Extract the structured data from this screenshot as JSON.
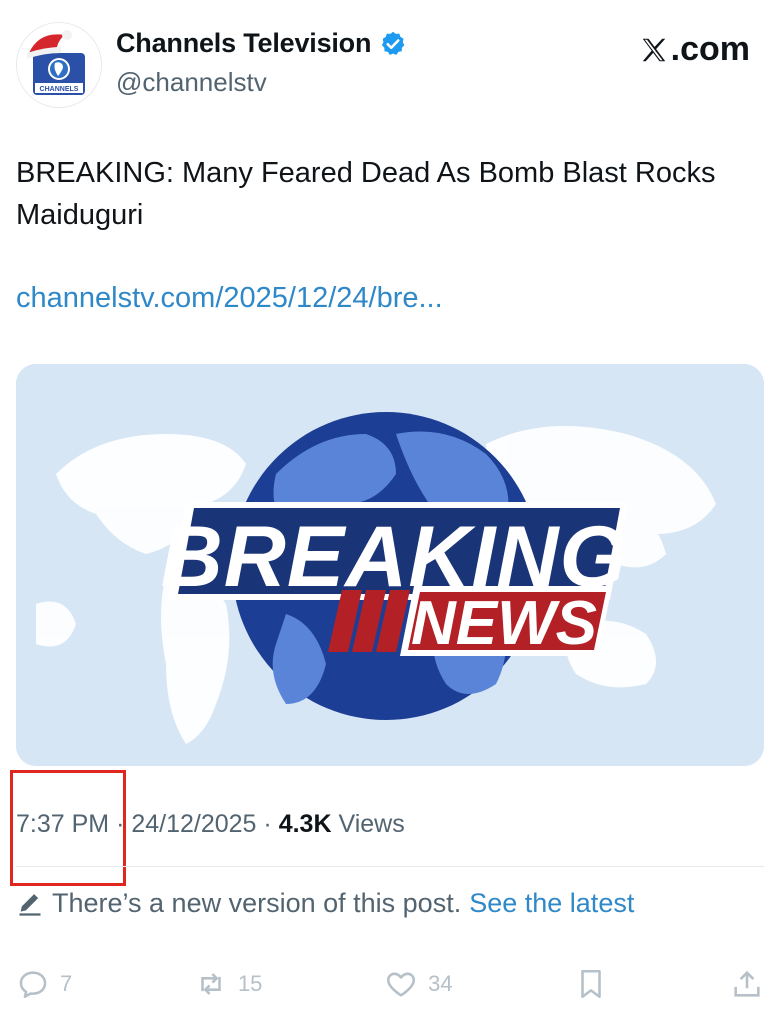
{
  "header": {
    "display_name": "Channels Television",
    "handle": "@channelstv",
    "site": "X.com",
    "site_rest": ".com",
    "avatar_logo_text": "CHANNELS",
    "verified": true
  },
  "post": {
    "text": "BREAKING: Many Feared Dead As Bomb Blast Rocks Maiduguri",
    "link": "channelstv.com/2025/12/24/bre..."
  },
  "media": {
    "headline_top": "BREAKING",
    "headline_bottom": "NEWS"
  },
  "meta": {
    "time": "7:37 PM",
    "separator": "·",
    "date": "24/12/2025",
    "views_count": "4.3K",
    "views_label": "Views"
  },
  "notice": {
    "text": "There’s a new version of this post.",
    "link": "See the latest"
  },
  "actions": {
    "replies": "7",
    "reposts": "15",
    "likes": "34"
  },
  "colors": {
    "accent_link": "#2f88c8",
    "verified_badge": "#1d9bf0",
    "highlight_box": "#e0261f",
    "muted_text": "#536471",
    "headline_navy": "#1a3478",
    "headline_red": "#b32025"
  },
  "icons": {
    "verified": "verified-badge-icon",
    "site": "x-logo-icon",
    "notice": "pencil-icon",
    "reply": "reply-icon",
    "repost": "repost-icon",
    "like": "heart-icon",
    "bookmark": "bookmark-icon",
    "share": "share-icon"
  }
}
